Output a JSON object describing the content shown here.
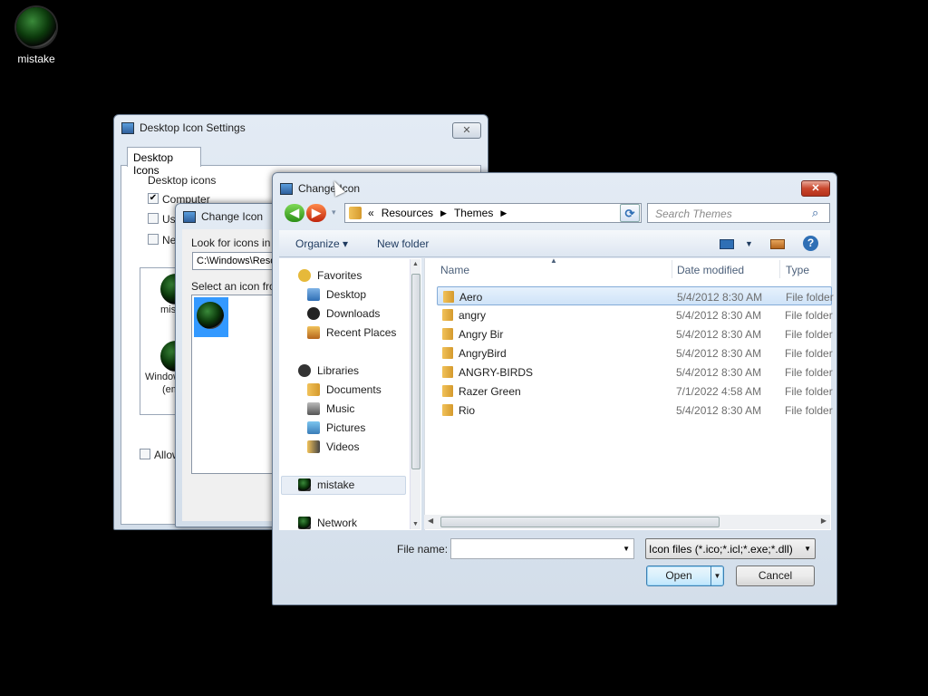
{
  "desktop": {
    "icon_label": "mistake"
  },
  "desktop_icon_settings": {
    "title": "Desktop Icon Settings",
    "close_label": "✕",
    "tab": "Desktop Icons",
    "group_label": "Desktop icons",
    "checkboxes": [
      {
        "label": "Computer",
        "checked": true
      },
      {
        "label": "Use",
        "checked": false
      },
      {
        "label": "Ne",
        "checked": false
      }
    ],
    "icon_labels": [
      "mist",
      "Window",
      "(em"
    ],
    "allow_label": "Allow"
  },
  "change_icon_small": {
    "title": "Change Icon",
    "look_label": "Look for icons in th",
    "path_value": "C:\\Windows\\Reso",
    "select_label": "Select an icon from"
  },
  "change_icon": {
    "title": "Change Icon",
    "close_label": "✕",
    "address": {
      "prefix": "«",
      "crumbs": [
        "Resources",
        "Themes"
      ]
    },
    "search_placeholder": "Search Themes",
    "toolbar": {
      "organize": "Organize ▾",
      "new_folder": "New folder",
      "help": "?"
    },
    "nav": {
      "favorites": "Favorites",
      "desktop": "Desktop",
      "downloads": "Downloads",
      "recent": "Recent Places",
      "libraries": "Libraries",
      "documents": "Documents",
      "music": "Music",
      "pictures": "Pictures",
      "videos": "Videos",
      "mistake": "mistake",
      "network": "Network"
    },
    "columns": {
      "name": "Name",
      "date": "Date modified",
      "type": "Type"
    },
    "files": [
      {
        "name": "Aero",
        "date": "5/4/2012 8:30 AM",
        "type": "File folder"
      },
      {
        "name": "angry",
        "date": "5/4/2012 8:30 AM",
        "type": "File folder"
      },
      {
        "name": "Angry Bir",
        "date": "5/4/2012 8:30 AM",
        "type": "File folder"
      },
      {
        "name": "AngryBird",
        "date": "5/4/2012 8:30 AM",
        "type": "File folder"
      },
      {
        "name": "ANGRY-BIRDS",
        "date": "5/4/2012 8:30 AM",
        "type": "File folder"
      },
      {
        "name": "Razer Green",
        "date": "7/1/2022 4:58 AM",
        "type": "File folder"
      },
      {
        "name": "Rio",
        "date": "5/4/2012 8:30 AM",
        "type": "File folder"
      }
    ],
    "file_name_label": "File name:",
    "file_name_value": "",
    "filter": "Icon files (*.ico;*.icl;*.exe;*.dll)",
    "open_label": "Open",
    "cancel_label": "Cancel"
  }
}
